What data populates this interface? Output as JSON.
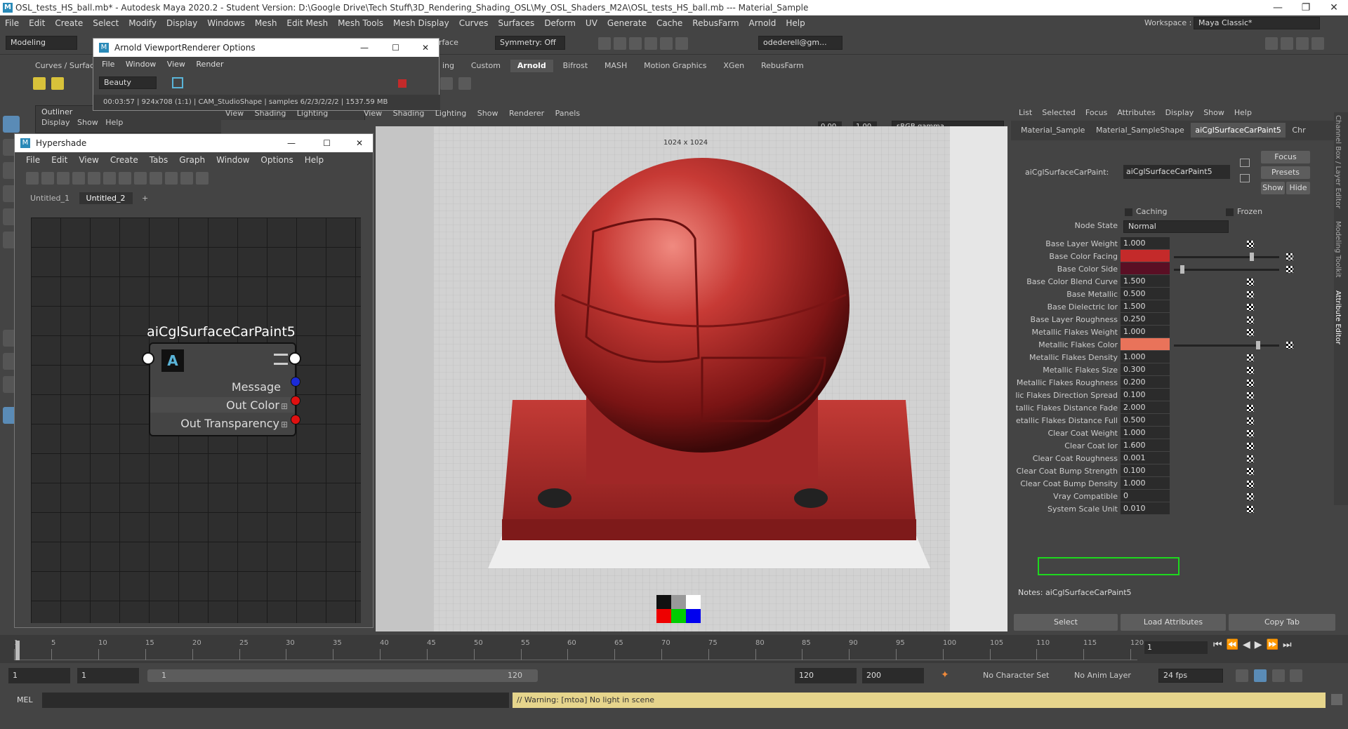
{
  "window": {
    "title": "OSL_tests_HS_ball.mb* - Autodesk Maya 2020.2 - Student Version: D:\\Google Drive\\Tech Stuff\\3D_Rendering_Shading_OSL\\My_OSL_Shaders_M2A\\OSL_tests_HS_ball.mb  ---  Material_Sample"
  },
  "menu": [
    "File",
    "Edit",
    "Create",
    "Select",
    "Modify",
    "Display",
    "Windows",
    "Mesh",
    "Edit Mesh",
    "Mesh Tools",
    "Mesh Display",
    "Curves",
    "Surfaces",
    "Deform",
    "UV",
    "Generate",
    "Cache",
    "RebusFarm",
    "Arnold",
    "Help"
  ],
  "workspace": {
    "label": "Workspace :",
    "value": "Maya Classic*"
  },
  "status": {
    "mode": "Modeling",
    "surface_fragment": "rface",
    "symmetry": "Symmetry: Off",
    "user": "odederell@gm..."
  },
  "shelf_tabs": [
    "Curves / Surface",
    "ing",
    "Custom",
    "Arnold",
    "Bifrost",
    "MASH",
    "Motion Graphics",
    "XGen",
    "RebusFarm"
  ],
  "arnold_window": {
    "title": "Arnold ViewportRenderer Options",
    "menu": [
      "File",
      "Window",
      "View",
      "Render"
    ],
    "aov": "Beauty",
    "status": "00:03:57 | 924x708 (1:1) | CAM_StudioShape | samples 6/2/3/2/2/2 | 1537.59 MB"
  },
  "outliner": {
    "title": "Outliner",
    "menu": [
      "Display",
      "Show",
      "Help"
    ]
  },
  "panel_menu_left": [
    "View",
    "Shading",
    "Lighting"
  ],
  "viewport": {
    "menu": [
      "View",
      "Shading",
      "Lighting",
      "Show",
      "Renderer",
      "Panels"
    ],
    "exposure": "0.00",
    "gamma": "1.00",
    "colorspace": "sRGB gamma",
    "resolution": "1024 x 1024"
  },
  "hypershade": {
    "title": "Hypershade",
    "menu": [
      "File",
      "Edit",
      "View",
      "Create",
      "Tabs",
      "Graph",
      "Window",
      "Options",
      "Help"
    ],
    "tabs": [
      "Untitled_1",
      "Untitled_2",
      "+"
    ],
    "node": {
      "name": "aiCglSurfaceCarPaint5",
      "ports": [
        "Message",
        "Out Color",
        "Out Transparency"
      ]
    }
  },
  "attr_editor": {
    "menu": [
      "List",
      "Selected",
      "Focus",
      "Attributes",
      "Display",
      "Show",
      "Help"
    ],
    "tabs": [
      "Material_Sample",
      "Material_SampleShape",
      "aiCglSurfaceCarPaint5",
      "Chr"
    ],
    "node_label": "aiCglSurfaceCarPaint:",
    "node_value": "aiCglSurfaceCarPaint5",
    "focus": "Focus",
    "presets": "Presets",
    "show": "Show",
    "hide": "Hide",
    "caching": "Caching",
    "frozen": "Frozen",
    "node_state_label": "Node State",
    "node_state": "Normal",
    "attributes": [
      {
        "label": "Base Layer Weight",
        "value": "1.000",
        "color": ""
      },
      {
        "label": "Base Color Facing",
        "value": "",
        "color": "#c42a2a",
        "slider": 0.72
      },
      {
        "label": "Base Color Side",
        "value": "",
        "color": "#5a0f24",
        "slider": 0.06
      },
      {
        "label": "Base Color Blend Curve",
        "value": "1.500",
        "color": ""
      },
      {
        "label": "Base Metallic",
        "value": "0.500",
        "color": ""
      },
      {
        "label": "Base Dielectric Ior",
        "value": "1.500",
        "color": ""
      },
      {
        "label": "Base Layer Roughness",
        "value": "0.250",
        "color": ""
      },
      {
        "label": "Metallic Flakes Weight",
        "value": "1.000",
        "color": ""
      },
      {
        "label": "Metallic Flakes Color",
        "value": "",
        "color": "#e9735a",
        "slider": 0.78
      },
      {
        "label": "Metallic Flakes Density",
        "value": "1.000",
        "color": ""
      },
      {
        "label": "Metallic Flakes Size",
        "value": "0.300",
        "color": ""
      },
      {
        "label": "Metallic Flakes Roughness",
        "value": "0.200",
        "color": ""
      },
      {
        "label": "lic Flakes Direction Spread",
        "value": "0.100",
        "color": ""
      },
      {
        "label": "tallic Flakes Distance Fade",
        "value": "2.000",
        "color": ""
      },
      {
        "label": "etallic Flakes Distance Full",
        "value": "0.500",
        "color": ""
      },
      {
        "label": "Clear Coat Weight",
        "value": "1.000",
        "color": ""
      },
      {
        "label": "Clear Coat Ior",
        "value": "1.600",
        "color": ""
      },
      {
        "label": "Clear Coat Roughness",
        "value": "0.001",
        "color": ""
      },
      {
        "label": "Clear Coat Bump Strength",
        "value": "0.100",
        "color": ""
      },
      {
        "label": "Clear Coat Bump Density",
        "value": "1.000",
        "color": ""
      },
      {
        "label": "Vray Compatible",
        "value": "0",
        "color": ""
      },
      {
        "label": "System Scale Unit",
        "value": "0.010",
        "color": ""
      }
    ],
    "notes_label": "Notes:  aiCglSurfaceCarPaint5",
    "buttons": [
      "Select",
      "Load Attributes",
      "Copy Tab"
    ],
    "side_tabs": [
      "Channel Box / Layer Editor",
      "Modeling Toolkit",
      "Attribute Editor"
    ]
  },
  "timeline": {
    "ticks": [
      "1",
      "5",
      "10",
      "15",
      "20",
      "25",
      "30",
      "35",
      "40",
      "45",
      "50",
      "55",
      "60",
      "65",
      "70",
      "75",
      "80",
      "85",
      "90",
      "95",
      "100",
      "105",
      "110",
      "115",
      "120"
    ],
    "current": "1"
  },
  "range": {
    "start": "1",
    "range_start": "1",
    "slider_start": "1",
    "slider_end": "120",
    "range_end": "120",
    "end": "200",
    "char_set": "No Character Set",
    "anim_layer": "No Anim Layer",
    "fps": "24 fps"
  },
  "command": {
    "lang": "MEL",
    "warning": "// Warning: [mtoa] No light in scene"
  }
}
